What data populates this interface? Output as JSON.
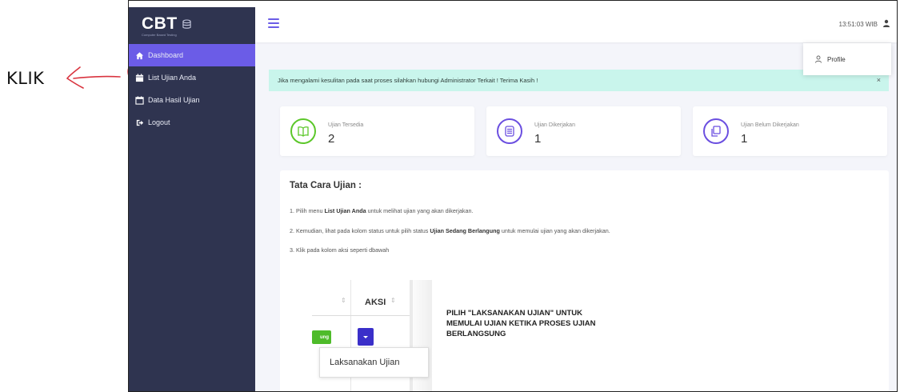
{
  "annotation": {
    "caption": "KLIK"
  },
  "brand": {
    "title": "CBT",
    "subtitle": "Computer Based Testing"
  },
  "sidebar": {
    "items": [
      {
        "label": "Dashboard",
        "active": true
      },
      {
        "label": "List Ujian Anda",
        "active": false
      },
      {
        "label": "Data Hasil Ujian",
        "active": false
      },
      {
        "label": "Logout",
        "active": false
      }
    ]
  },
  "topbar": {
    "time": "13:51:03",
    "timezone": "WIB"
  },
  "dropdown": {
    "profile_label": "Profile"
  },
  "alert": {
    "text": "Jika mengalami kesulitan pada saat proses silahkan hubungi Administrator Terkait ! Terima Kasih !",
    "close": "×"
  },
  "stats": [
    {
      "label": "Ujian Tersedia",
      "value": "2",
      "color": "#5cc72a"
    },
    {
      "label": "Ujian Dikerjakan",
      "value": "1",
      "color": "#6b4fe0"
    },
    {
      "label": "Ujian Belum Dikerjakan",
      "value": "1",
      "color": "#6b4fe0"
    }
  ],
  "instructions": {
    "title": "Tata Cara Ujian :",
    "step1": {
      "prefix": "1. Pilih menu ",
      "bold": "List Ujian Anda",
      "suffix": " untuk melihat ujian yang akan dikerjakan."
    },
    "step2": {
      "prefix": "2. Kemudian, lihat pada kolom status untuk pilih status ",
      "bold": "Ujian Sedang Berlangung",
      "suffix": " untuk memulai ujian yang akan dikerjakan."
    },
    "step3": "3. Klik pada kolom aksi seperti dbawah"
  },
  "illustration": {
    "column_header": "AKSI",
    "status_chip": "ung",
    "menu_item": "Laksanakan Ujian",
    "hint": "PILIH \"LAKSANAKAN UJIAN\" UNTUK MEMULAI UJIAN KETIKA PROSES UJIAN BERLANGSUNG"
  },
  "colors": {
    "sidebar_bg": "#2f3450",
    "accent": "#6b5ce7",
    "alert_bg": "#c9f5ec",
    "annotation_ink": "#d9343f"
  }
}
